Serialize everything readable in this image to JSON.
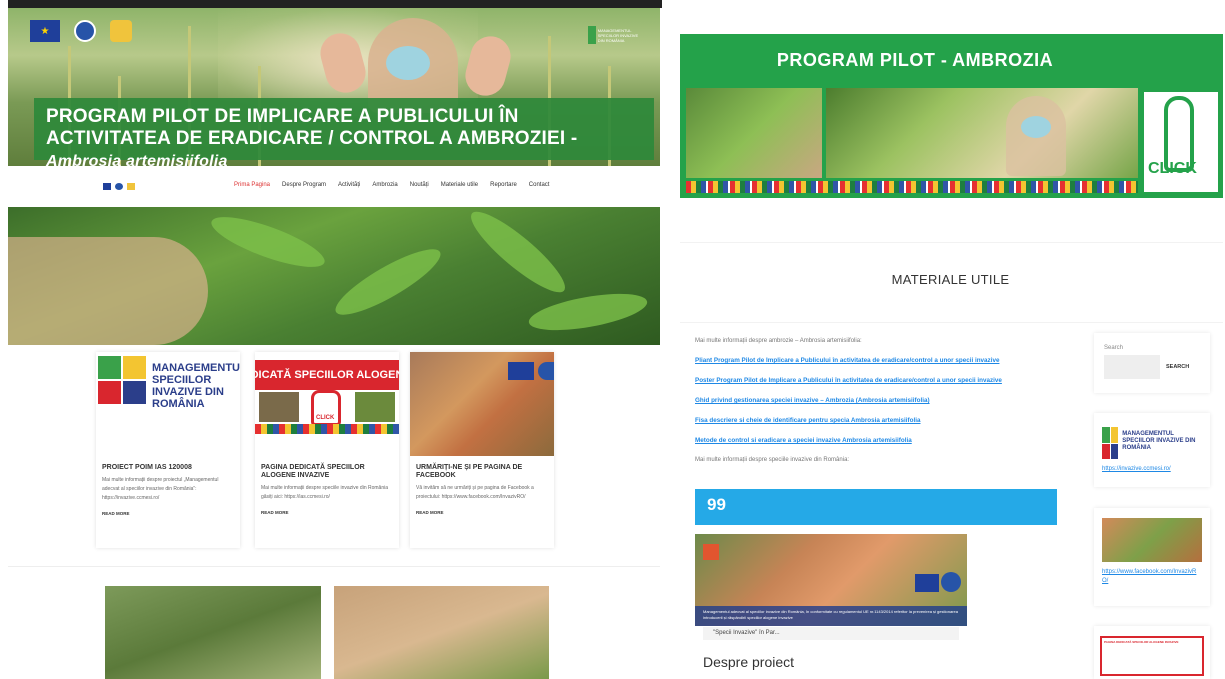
{
  "left": {
    "hero": {
      "title_line1": "PROGRAM PILOT DE IMPLICARE A PUBLICULUI ÎN",
      "title_line2": "ACTIVITATEA DE ERADICARE / CONTROL A AMBROZIEI - ",
      "title_species": "Ambrosia artemisiifolia",
      "brand_text": "MANAGEMENTUL SPECIILOR INVAZIVE DIN ROMÂNIA"
    },
    "nav": {
      "items": [
        "Prima Pagina",
        "Despre Program",
        "Activități",
        "Ambrozia",
        "Noutăți",
        "Materiale utile",
        "Reportare",
        "Contact"
      ],
      "active": "Prima Pagina"
    },
    "cards": [
      {
        "logo_text": "MANAGEMENTUL SPECIILOR INVAZIVE DIN ROMÂNIA",
        "title": "PROIECT POIM IAS 120008",
        "text": "Mai multe informații despre proiectul „Managementul adecvat al speciilor invazive din România”: https://invazive.ccmesi.ro/",
        "more": "READ MORE"
      },
      {
        "banner": "EDICATĂ SPECIILOR ALOGENE",
        "click": "CLICK",
        "title": "PAGINA DEDICATĂ SPECIILOR ALOGENE INVAZIVE",
        "text": "Mai multe informații despre speciile invazive din România găsiți aici: https://ias.ccmesi.ro/",
        "more": "READ MORE"
      },
      {
        "title": "URMĂRIȚI-NE ȘI PE PAGINA DE FACEBOOK",
        "text": "Vă invităm să ne urmăriți și pe pagina de Facebook a proiectului: https://www.facebook.com/InvazivRO/",
        "more": "READ MORE"
      }
    ]
  },
  "right": {
    "banner": {
      "title": "PROGRAM PILOT - AMBROZIA",
      "click": "CLICK"
    },
    "section_title": "MATERIALE UTILE",
    "intro": "Mai multe informații despre ambrozie – Ambrosia artemisiifolia:",
    "links": [
      "Pliant Program Pilot de Implicare a Publicului în activitatea de eradicare/control a unor specii invazive",
      "Poster Program Pilot de Implicare a Publicului în activitatea de eradicare/control a unor specii invazive",
      "Ghid privind gestionarea speciei invazive – Ambrozia (Ambrosia artemisiifolia)",
      "Fisa descriere si cheie de identificare pentru specia Ambrosia artemisiifolia",
      "Metode de control si eradicare a speciei invazive Ambrosia artemisiifolia"
    ],
    "intro2": "Mai multe informații despre speciile invazive din România:",
    "quote_mark": "99",
    "fb_caption": "Managementul adecvat al speciilor invazive din România, în conformitate cu regulamentul UE nr.1143/2014 referitor la prevenirea și gestionarea introducerii și răspândirii speciilor alogene invazive",
    "fb_bar": "\"Specii Invazive\" în Par...",
    "about_title": "Despre proiect",
    "sidebar": {
      "search_label": "Search",
      "search_button": "SEARCH",
      "logo_text": "MANAGEMENTUL SPECIILOR INVAZIVE DIN ROMÂNIA",
      "link1": "https://invazive.ccmesi.ro/",
      "link2": "https://www.facebook.com/InvazivRO/",
      "thumb_banner": "PAGINA DEDICATĂ SPECIILOR ALOGENE INVAZIVE"
    }
  }
}
